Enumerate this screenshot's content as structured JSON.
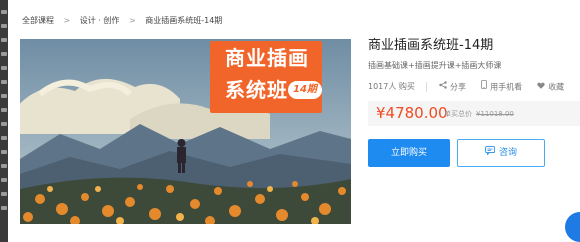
{
  "breadcrumb": {
    "items": [
      "全部课程",
      "设计 · 创作",
      "商业插画系统班-14期"
    ],
    "separator": ">"
  },
  "hero": {
    "title_line_1": "商业插画",
    "title_line_2": "系统班",
    "tag": "14期"
  },
  "course": {
    "title": "商业插画系统班-14期",
    "subtitle": "插画基础课+插画提升课+插画大师课",
    "buyers": "1017人 购买",
    "share": "分享",
    "mobile": "用手机看",
    "collect": "收藏"
  },
  "pricing": {
    "price": "¥4780.00",
    "original_label": "单买总价",
    "original_price": "¥11018.00"
  },
  "actions": {
    "buy": "立即购买",
    "consult": "咨询"
  },
  "colors": {
    "accent": "#1e8bf0",
    "price": "#f04a23",
    "badge": "#f2652a"
  },
  "icons": [
    "chevron-right-icon",
    "share-icon",
    "phone-icon",
    "heart-icon",
    "chat-icon"
  ]
}
